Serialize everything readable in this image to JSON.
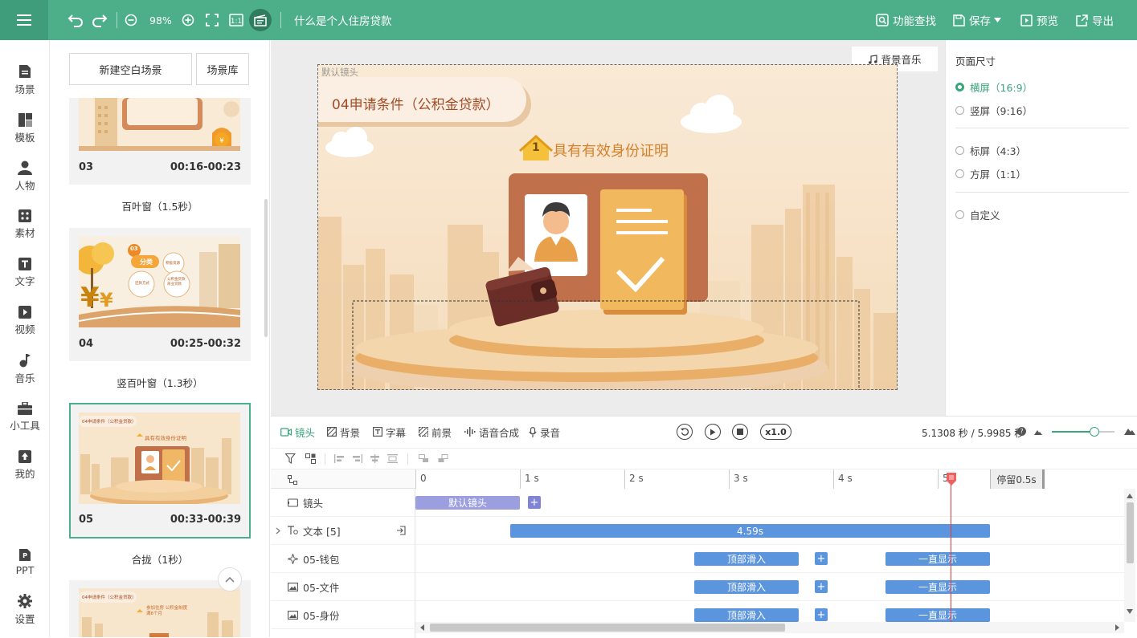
{
  "topbar": {
    "zoom": "98%",
    "doc_title": "什么是个人住房贷款",
    "find_label": "功能查找",
    "save_label": "保存",
    "preview_label": "预览",
    "export_label": "导出"
  },
  "sidenav": {
    "items": [
      {
        "label": "场景",
        "icon": "scene-icon"
      },
      {
        "label": "模板",
        "icon": "template-icon"
      },
      {
        "label": "人物",
        "icon": "person-icon"
      },
      {
        "label": "素材",
        "icon": "material-icon"
      },
      {
        "label": "文字",
        "icon": "text-icon"
      },
      {
        "label": "视频",
        "icon": "video-icon"
      },
      {
        "label": "音乐",
        "icon": "music-icon"
      },
      {
        "label": "小工具",
        "icon": "toolbox-icon"
      },
      {
        "label": "我的",
        "icon": "my-icon"
      }
    ],
    "bottom": [
      {
        "label": "PPT",
        "icon": "ppt-icon"
      },
      {
        "label": "设置",
        "icon": "settings-icon"
      }
    ]
  },
  "scenes": {
    "new_blank": "新建空白场景",
    "library": "场景库",
    "cards": [
      {
        "num": "03",
        "time": "00:16-00:23",
        "transition": "百叶窗（1.5秒）"
      },
      {
        "num": "04",
        "time": "00:25-00:32",
        "transition": "竖百叶窗（1.3秒）"
      },
      {
        "num": "05",
        "time": "00:33-00:39",
        "transition": "合拢（1秒）"
      }
    ],
    "thumb04_badge": "03",
    "thumb04_title": "分类",
    "thumb04_b1": "积极资源",
    "thumb04_b2": "还款方式",
    "thumb04_b3": "公积金贷款 商业贷款",
    "thumb05_title": "04申请条件（公积金贷款）",
    "thumb05_sub": "具有有效身份证明",
    "thumb06_title": "04申请条件（公积金贷款）",
    "thumb06_sub": "参加住房 公积金制度满6个月"
  },
  "canvas": {
    "camera_label": "默认镜头",
    "bg_music": "背景音乐",
    "title": "04申请条件（公积金贷款）",
    "badge_num": "1",
    "subtitle": "具有有效身份证明"
  },
  "props": {
    "heading": "页面尺寸",
    "options": [
      {
        "label": "横屏（16:9）",
        "selected": true
      },
      {
        "label": "竖屏（9:16）",
        "selected": false
      },
      {
        "label": "标屏（4:3）",
        "selected": false
      },
      {
        "label": "方屏（1:1）",
        "selected": false
      },
      {
        "label": "自定义",
        "selected": false
      }
    ]
  },
  "timeline": {
    "tools": [
      {
        "label": "镜头",
        "active": true
      },
      {
        "label": "背景",
        "active": false
      },
      {
        "label": "字幕",
        "active": false
      },
      {
        "label": "前景",
        "active": false
      },
      {
        "label": "语音合成",
        "active": false
      },
      {
        "label": "录音",
        "active": false
      }
    ],
    "speed": "x1.0",
    "time_readout": "5.1308 秒 / 5.9985 秒",
    "ruler": [
      "0",
      "1 s",
      "2 s",
      "3 s",
      "4 s",
      "5"
    ],
    "pause_label": "停留0.5s",
    "playhead_seconds": 5.13,
    "rows": [
      {
        "label": "镜头"
      },
      {
        "label": "文本 [5]"
      },
      {
        "label": "05-钱包"
      },
      {
        "label": "05-文件"
      },
      {
        "label": "05-身份"
      }
    ],
    "camera_clip": "默认镜头",
    "text_clip": "4.59s",
    "enter_clip": "顶部滑入",
    "stay_clip": "一直显示"
  }
}
